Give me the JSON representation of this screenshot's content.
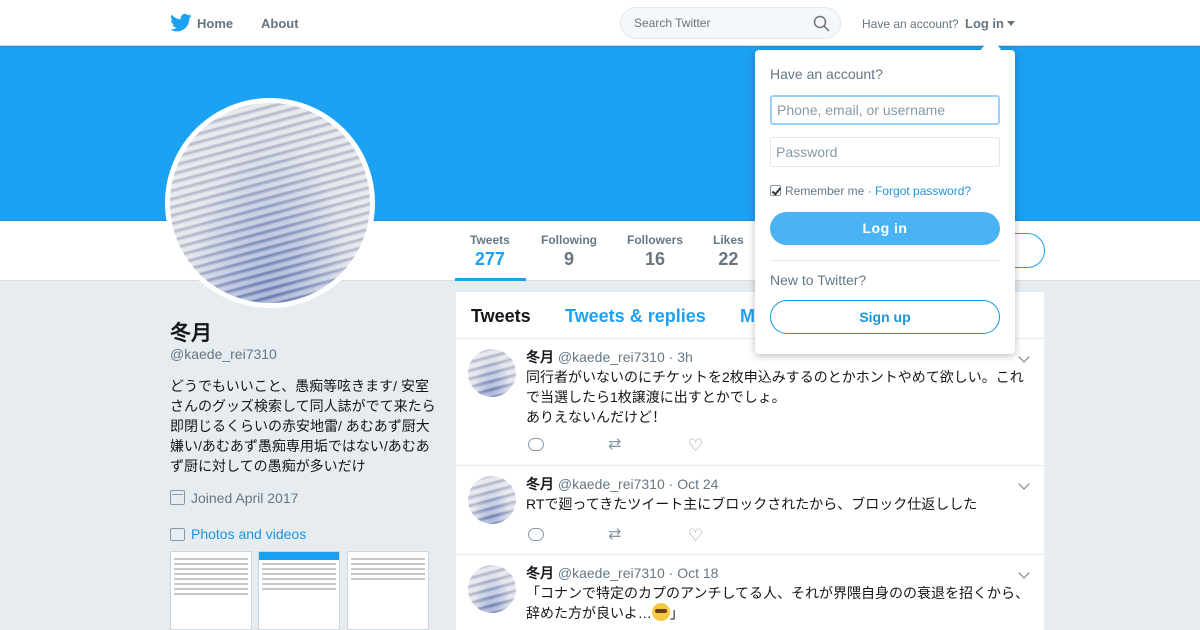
{
  "nav": {
    "home": "Home",
    "about": "About",
    "search_placeholder": "Search Twitter",
    "have_account": "Have an account?",
    "login": "Log in"
  },
  "colors": {
    "brand": "#1da1f2",
    "link": "#1b95e0",
    "muted": "#657786"
  },
  "stats": [
    {
      "label": "Tweets",
      "value": "277",
      "active": true
    },
    {
      "label": "Following",
      "value": "9"
    },
    {
      "label": "Followers",
      "value": "16"
    },
    {
      "label": "Likes",
      "value": "22"
    }
  ],
  "profile": {
    "name": "冬月",
    "handle": "@kaede_rei7310",
    "bio": "どうでもいいこと、愚痴等呟きます/ 安室さんのグッズ検索して同人誌がでて来たら即閉じるくらいの赤安地雷/ あむあず厨大嫌い/あむあず愚痴専用垢ではない/あむあず厨に対しての愚痴が多いだけ",
    "joined": "Joined April 2017",
    "photos_link": "Photos and videos"
  },
  "timeline": {
    "tabs": [
      "Tweets",
      "Tweets & replies",
      "M"
    ],
    "tweets": [
      {
        "name": "冬月",
        "handle": "@kaede_rei7310",
        "time": "3h",
        "lines": [
          "同行者がいないのにチケットを2枚申込みするのとかホントやめて欲しい。これで当選したら1枚譲渡に出すとかでしょ。",
          "ありえないんだけど！"
        ]
      },
      {
        "name": "冬月",
        "handle": "@kaede_rei7310",
        "time": "Oct 24",
        "lines": [
          "RTで廻ってきたツイート主にブロックされたから、ブロック仕返しした"
        ]
      },
      {
        "name": "冬月",
        "handle": "@kaede_rei7310",
        "time": "Oct 18",
        "lines": [
          "「コナンで特定のカプのアンチしてる人、それが界隈自身のの衰退を招くから、",
          "辞めた方が良いよ…"
        ],
        "line2_suffix": "」"
      }
    ]
  },
  "login_dropdown": {
    "title": "Have an account?",
    "username_placeholder": "Phone, email, or username",
    "password_placeholder": "Password",
    "remember": "Remember me",
    "separator": " · ",
    "forgot": "Forgot password?",
    "login_button": "Log in",
    "new_to": "New to Twitter?",
    "signup_button": "Sign up"
  }
}
